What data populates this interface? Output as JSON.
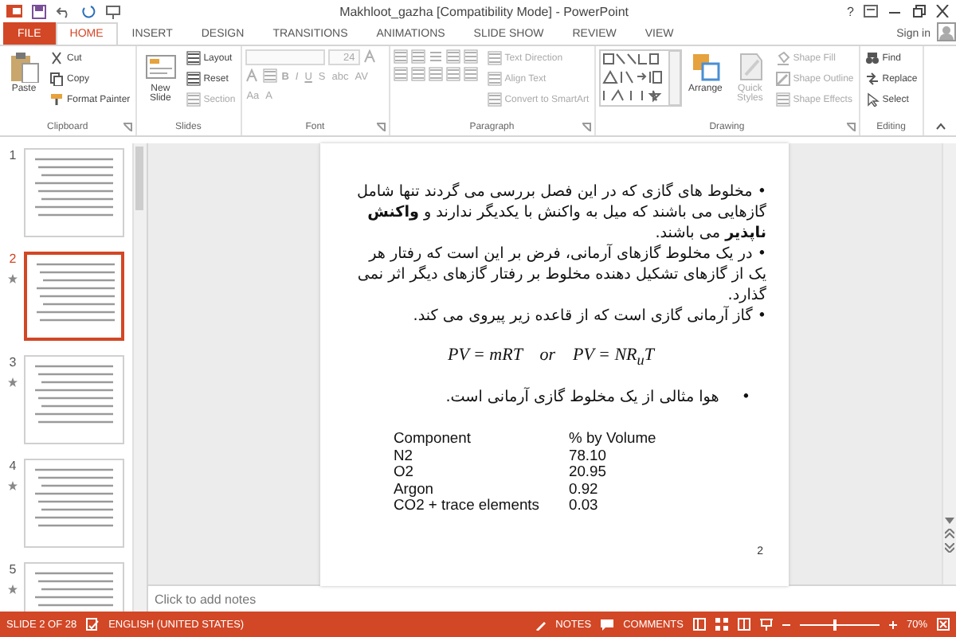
{
  "window": {
    "title": "Makhloot_gazha [Compatibility Mode] - PowerPoint",
    "help": "?"
  },
  "account": {
    "label": "Sign in"
  },
  "tabs": [
    {
      "label": "FILE",
      "kind": "file",
      "selected": false
    },
    {
      "label": "HOME",
      "kind": "tab",
      "selected": true
    },
    {
      "label": "INSERT",
      "kind": "tab",
      "selected": false
    },
    {
      "label": "DESIGN",
      "kind": "tab",
      "selected": false
    },
    {
      "label": "TRANSITIONS",
      "kind": "tab",
      "selected": false
    },
    {
      "label": "ANIMATIONS",
      "kind": "tab",
      "selected": false
    },
    {
      "label": "SLIDE SHOW",
      "kind": "tab",
      "selected": false
    },
    {
      "label": "REVIEW",
      "kind": "tab",
      "selected": false
    },
    {
      "label": "VIEW",
      "kind": "tab",
      "selected": false
    }
  ],
  "ribbon": {
    "groups": [
      {
        "label": "Clipboard",
        "launcher": true,
        "items": [
          {
            "kind": "large",
            "label": "Paste",
            "disabled": false
          },
          {
            "kind": "small",
            "label": "Cut",
            "disabled": false
          },
          {
            "kind": "small",
            "label": "Copy",
            "disabled": false
          },
          {
            "kind": "small",
            "label": "Format Painter",
            "disabled": false
          }
        ]
      },
      {
        "label": "Slides",
        "launcher": false,
        "items": [
          {
            "kind": "large",
            "label": "New Slide",
            "disabled": false
          },
          {
            "kind": "small",
            "label": "Layout",
            "disabled": false
          },
          {
            "kind": "small",
            "label": "Reset",
            "disabled": false
          },
          {
            "kind": "small",
            "label": "Section",
            "disabled": true
          }
        ]
      },
      {
        "label": "Font",
        "launcher": true,
        "items": [
          {
            "kind": "field",
            "disabled": true
          },
          {
            "kind": "field",
            "value": "24",
            "disabled": true
          },
          {
            "kind": "icon",
            "disabled": true
          },
          {
            "kind": "icon",
            "disabled": true
          },
          {
            "kind": "icon",
            "disabled": true
          },
          {
            "kind": "glyph",
            "label": "B",
            "disabled": true
          },
          {
            "kind": "glyph",
            "label": "I",
            "disabled": true
          },
          {
            "kind": "glyph",
            "label": "U",
            "disabled": true
          },
          {
            "kind": "glyph",
            "label": "S",
            "disabled": true
          },
          {
            "kind": "glyph",
            "label": "abc",
            "disabled": true
          },
          {
            "kind": "glyph",
            "label": "AV",
            "disabled": true
          },
          {
            "kind": "glyph",
            "label": "Aa",
            "disabled": true
          },
          {
            "kind": "glyph",
            "label": "A",
            "disabled": true
          }
        ]
      },
      {
        "label": "Paragraph",
        "launcher": true,
        "items": [
          {
            "kind": "icon",
            "disabled": true
          },
          {
            "kind": "icon",
            "disabled": true
          },
          {
            "kind": "icon",
            "disabled": true
          },
          {
            "kind": "icon",
            "disabled": true
          },
          {
            "kind": "icon",
            "disabled": true
          },
          {
            "kind": "icon",
            "disabled": true
          },
          {
            "kind": "icon",
            "disabled": true
          },
          {
            "kind": "icon",
            "disabled": true
          },
          {
            "kind": "icon",
            "disabled": true
          },
          {
            "kind": "icon",
            "disabled": true
          },
          {
            "kind": "small",
            "label": "Text Direction",
            "disabled": true
          },
          {
            "kind": "small",
            "label": "Align Text",
            "disabled": true
          },
          {
            "kind": "small",
            "label": "Convert to SmartArt",
            "disabled": true
          }
        ]
      },
      {
        "label": "Drawing",
        "launcher": true,
        "items": [
          {
            "kind": "gallery",
            "disabled": false
          },
          {
            "kind": "large",
            "label": "Arrange",
            "disabled": false
          },
          {
            "kind": "large",
            "label": "Quick Styles",
            "disabled": true
          },
          {
            "kind": "small",
            "label": "Shape Fill",
            "disabled": true
          },
          {
            "kind": "small",
            "label": "Shape Outline",
            "disabled": true
          },
          {
            "kind": "small",
            "label": "Shape Effects",
            "disabled": true
          }
        ]
      },
      {
        "label": "Editing",
        "launcher": false,
        "items": [
          {
            "kind": "small",
            "label": "Find",
            "disabled": false
          },
          {
            "kind": "small",
            "label": "Replace",
            "disabled": false
          },
          {
            "kind": "small",
            "label": "Select",
            "disabled": false
          }
        ]
      }
    ]
  },
  "slides_pane": {
    "thumbnails": [
      {
        "number": "1",
        "selected": false,
        "animated": false
      },
      {
        "number": "2",
        "selected": true,
        "animated": true
      },
      {
        "number": "3",
        "selected": false,
        "animated": true
      },
      {
        "number": "4",
        "selected": false,
        "animated": true
      },
      {
        "number": "5",
        "selected": false,
        "animated": true
      }
    ]
  },
  "slide": {
    "paragraphs": [
      "• مخلوط های گازی که در این فصل بررسی می گردند تنها شامل گازهایی می باشند که میل به واکنش با یکدیگر ندارند و **واکنش ناپذیر** می باشند.",
      "• در یک مخلوط گازهای آرمانی، فرض بر این است که رفتار هر یک از گازهای تشکیل دهنده مخلوط بر رفتار گازهای دیگر اثر نمی گذارد.",
      "• گاز آرمانی گازی است که از قاعده زیر پیروی می کند."
    ],
    "equation": "PV = mRT    or    PV = NR$_{u}$T",
    "example_bullet": "•",
    "example": "هوا  مثالی از یک مخلوط گازی آرمانی است.",
    "table": {
      "columns": [
        "Component",
        "% by Volume"
      ],
      "rows": [
        [
          "N2",
          "78.10"
        ],
        [
          "O2",
          "20.95"
        ],
        [
          "Argon",
          "0.92"
        ],
        [
          "CO2  + trace  elements",
          "0.03"
        ]
      ]
    },
    "page_number": "2"
  },
  "notes": {
    "prompt": "Click to add notes"
  },
  "status_bar": {
    "slide": "SLIDE 2 OF 28",
    "language": "ENGLISH (UNITED STATES)",
    "notes": "NOTES",
    "comments": "COMMENTS",
    "zoom": {
      "level": 0.45
    },
    "zoom_reading": "70%"
  }
}
